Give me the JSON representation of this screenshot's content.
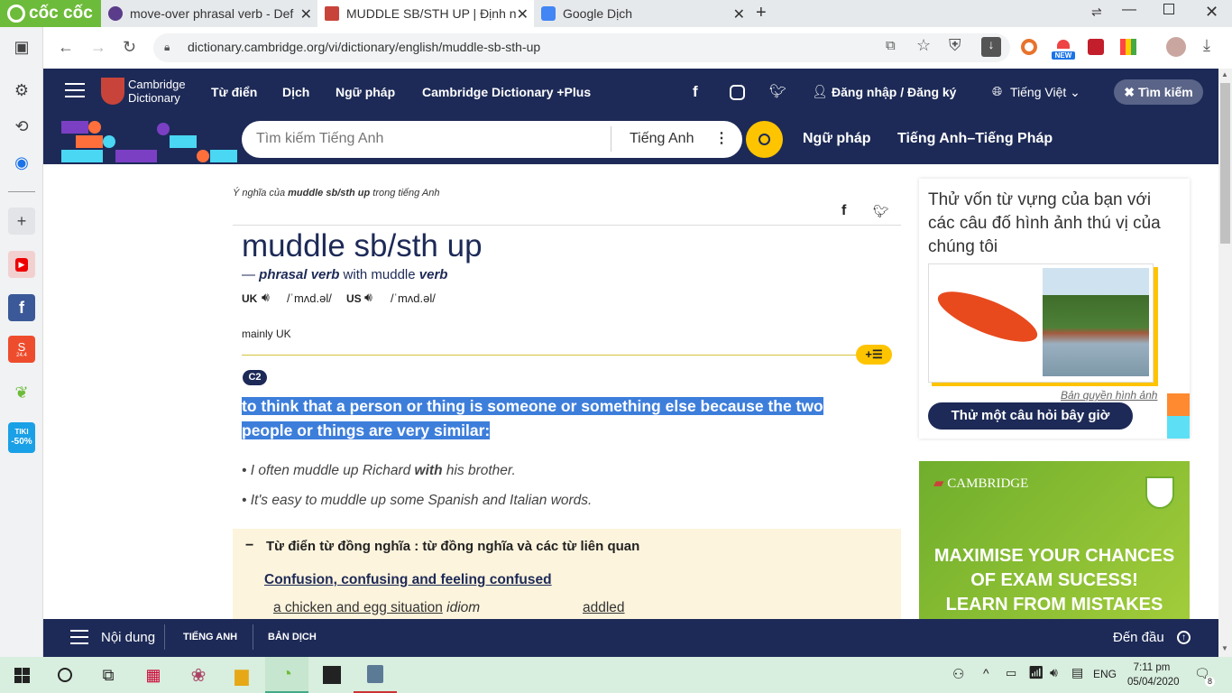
{
  "browser": {
    "brand": "cốc cốc",
    "tabs": [
      {
        "title": "move-over phrasal verb - Def",
        "active": false
      },
      {
        "title": "MUDDLE SB/STH UP | Định n",
        "active": true
      },
      {
        "title": "Google Dịch",
        "active": false
      }
    ],
    "url": "dictionary.cambridge.org/vi/dictionary/english/muddle-sb-sth-up",
    "badge_new": "NEW",
    "shopee_label": "24.4",
    "tiki_label": "TIKI",
    "tiki_discount": "-50%"
  },
  "site": {
    "logo_line1": "Cambridge",
    "logo_line2": "Dictionary",
    "nav": [
      "Từ điển",
      "Dịch",
      "Ngữ pháp",
      "Cambridge Dictionary +Plus"
    ],
    "login": "Đăng nhập / Đăng ký",
    "language": "Tiếng Việt",
    "search_button": "Tìm kiếm",
    "search_placeholder": "Tìm kiếm Tiếng Anh",
    "search_lang": "Tiếng Anh",
    "sub_nav": [
      "Ngữ pháp",
      "Tiếng Anh–Tiếng Pháp"
    ],
    "accent": "#1d2a57",
    "yellow": "#fec400"
  },
  "entry": {
    "breadcrumb_pre": "Ý nghĩa của ",
    "breadcrumb_word": "muddle sb/sth up",
    "breadcrumb_post": " trong tiếng Anh",
    "headword": "muddle sb/sth up",
    "pos_dash": "— ",
    "pos": "phrasal verb",
    "pos_with": " with muddle ",
    "pos_verb": "verb",
    "uk_label": "UK",
    "uk_ipa": "/ˈmʌd.əl/",
    "us_label": "US",
    "us_ipa": "/ˈmʌd.əl/",
    "usage": "mainly UK",
    "level": "C2",
    "definition_line1": "to think that a person or thing is someone or something else because the two",
    "definition_line2": "people or things are very similar:",
    "examples": [
      {
        "pre": "I often muddle up Richard ",
        "bold": "with",
        "post": " his brother."
      },
      {
        "pre": "It's easy to muddle up some Spanish and Italian words.",
        "bold": "",
        "post": ""
      }
    ],
    "synonyms_title": "Từ điển từ đồng nghĩa : từ đồng nghĩa và các từ liên quan",
    "synonyms_group": "Confusion, confusing and feeling confused",
    "syn_item1": "a chicken and egg situation",
    "syn_item1_tag": "idiom",
    "syn_item2": "addled"
  },
  "sidebar": {
    "quiz_title": "Thử vốn từ vựng của bạn với các câu đố hình ảnh thú vị của chúng tôi",
    "copyright": "Bản quyền hình ảnh",
    "quiz_button": "Thử một câu hỏi bây giờ",
    "ad_brand": "CAMBRIDGE",
    "ad_line1": "MAXIMISE YOUR CHANCES",
    "ad_line2": "OF EXAM SUCESS!",
    "ad_line3": "LEARN FROM MISTAKES"
  },
  "bottombar": {
    "menu": "Nội dung",
    "tab1": "TIẾNG ANH",
    "tab2": "BẢN DỊCH",
    "top": "Đến đầu"
  },
  "taskbar": {
    "lang": "ENG",
    "time": "7:11 pm",
    "date": "05/04/2020",
    "notifications": "8"
  }
}
